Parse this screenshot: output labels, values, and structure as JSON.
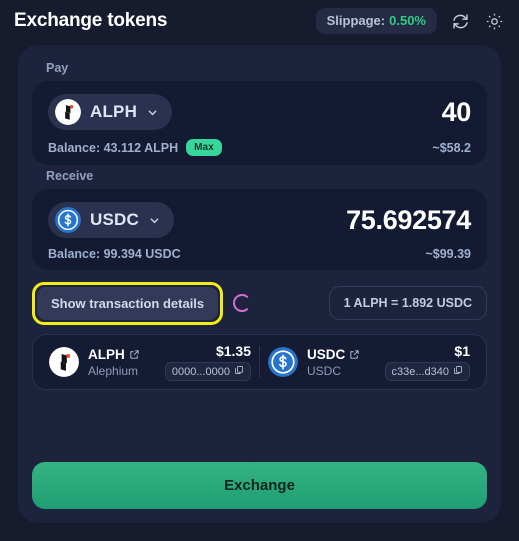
{
  "header": {
    "title": "Exchange tokens",
    "slippage_label": "Slippage:",
    "slippage_value": "0.50%",
    "refresh_icon": "refresh-icon",
    "settings_icon": "gear-icon"
  },
  "pay": {
    "label": "Pay",
    "token_symbol": "ALPH",
    "amount": "40",
    "balance": "Balance: 43.112 ALPH",
    "max_label": "Max",
    "usd_value": "~$58.2"
  },
  "swap": {
    "icon": "swap-vertical-icon"
  },
  "receive": {
    "label": "Receive",
    "token_symbol": "USDC",
    "amount": "75.692574",
    "balance": "Balance: 99.394 USDC",
    "usd_value": "~$99.39"
  },
  "details": {
    "button_label": "Show transaction details",
    "spinner": "loading-spinner",
    "rate": "1 ALPH = 1.892 USDC"
  },
  "tokens": [
    {
      "name": "ALPH",
      "subtitle": "Alephium",
      "price": "$1.35",
      "address": "0000...0000",
      "copy_icon": "copy-icon",
      "link_icon": "external-link-icon"
    },
    {
      "name": "USDC",
      "subtitle": "USDC",
      "price": "$1",
      "address": "c33e...d340",
      "copy_icon": "copy-icon",
      "link_icon": "external-link-icon"
    }
  ],
  "action": {
    "exchange_label": "Exchange"
  },
  "colors": {
    "page_bg": "#12172a",
    "card_bg": "#1d233c",
    "panel_bg": "#141a32",
    "accent_green": "#2ecc84",
    "focus_yellow": "#f2ee14",
    "spinner_pink": "#d070d8",
    "usdc_blue": "#2775ca"
  }
}
